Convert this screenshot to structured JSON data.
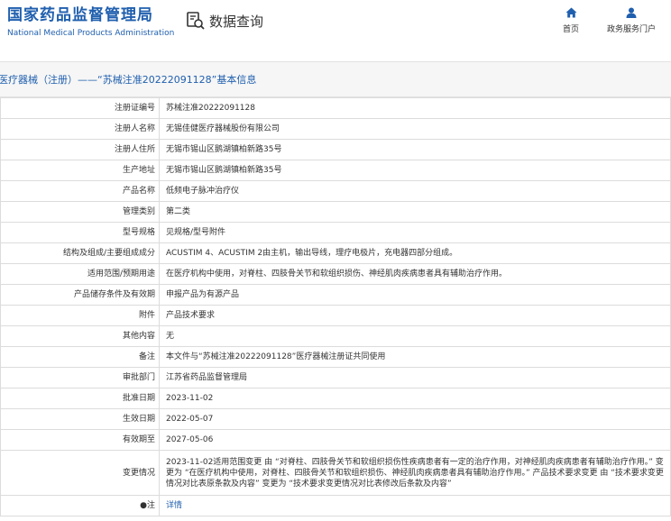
{
  "header": {
    "logo_cn": "国家药品监督管理局",
    "logo_en": "National Medical Products Administration",
    "query_label": "数据查询",
    "nav_home": "首页",
    "nav_portal": "政务服务门户"
  },
  "title": "医疗器械（注册）——“苏械注准20222091128”基本信息",
  "rows": [
    {
      "label": "注册证编号",
      "value": "苏械注准20222091128"
    },
    {
      "label": "注册人名称",
      "value": "无锡佳健医疗器械股份有限公司"
    },
    {
      "label": "注册人住所",
      "value": "无锡市锡山区鹅湖镇柏新路35号"
    },
    {
      "label": "生产地址",
      "value": "无锡市锡山区鹅湖镇柏新路35号"
    },
    {
      "label": "产品名称",
      "value": "低频电子脉冲治疗仪"
    },
    {
      "label": "管理类别",
      "value": "第二类"
    },
    {
      "label": "型号规格",
      "value": "见规格/型号附件"
    },
    {
      "label": "结构及组成/主要组成成分",
      "value": "ACUSTIM 4、ACUSTIM 2由主机，输出导线，理疗电极片，充电器四部分组成。"
    },
    {
      "label": "适用范围/预期用途",
      "value": "在医疗机构中使用，对脊柱、四肢骨关节和软组织损伤、神经肌肉疾病患者具有辅助治疗作用。"
    },
    {
      "label": "产品储存条件及有效期",
      "value": "申报产品为有源产品"
    },
    {
      "label": "附件",
      "value": "产品技术要求"
    },
    {
      "label": "其他内容",
      "value": "无"
    },
    {
      "label": "备注",
      "value": "本文件与“苏械注准20222091128”医疗器械注册证共同使用"
    },
    {
      "label": "审批部门",
      "value": "江苏省药品监督管理局"
    },
    {
      "label": "批准日期",
      "value": "2023-11-02"
    },
    {
      "label": "生效日期",
      "value": "2022-05-07"
    },
    {
      "label": "有效期至",
      "value": "2027-05-06"
    },
    {
      "label": "变更情况",
      "value": "2023-11-02适用范围变更 由 “对脊柱、四肢骨关节和软组织损伤性疾病患者有一定的治疗作用，对神经肌肉疾病患者有辅助治疗作用。” 变更为 “在医疗机构中使用，对脊柱、四肢骨关节和软组织损伤、神经肌肉疾病患者具有辅助治疗作用。” 产品技术要求变更 由 “技术要求变更情况对比表原条款及内容” 变更为 “技术要求变更情况对比表修改后条款及内容”"
    },
    {
      "label": "●注",
      "value": "详情"
    }
  ]
}
